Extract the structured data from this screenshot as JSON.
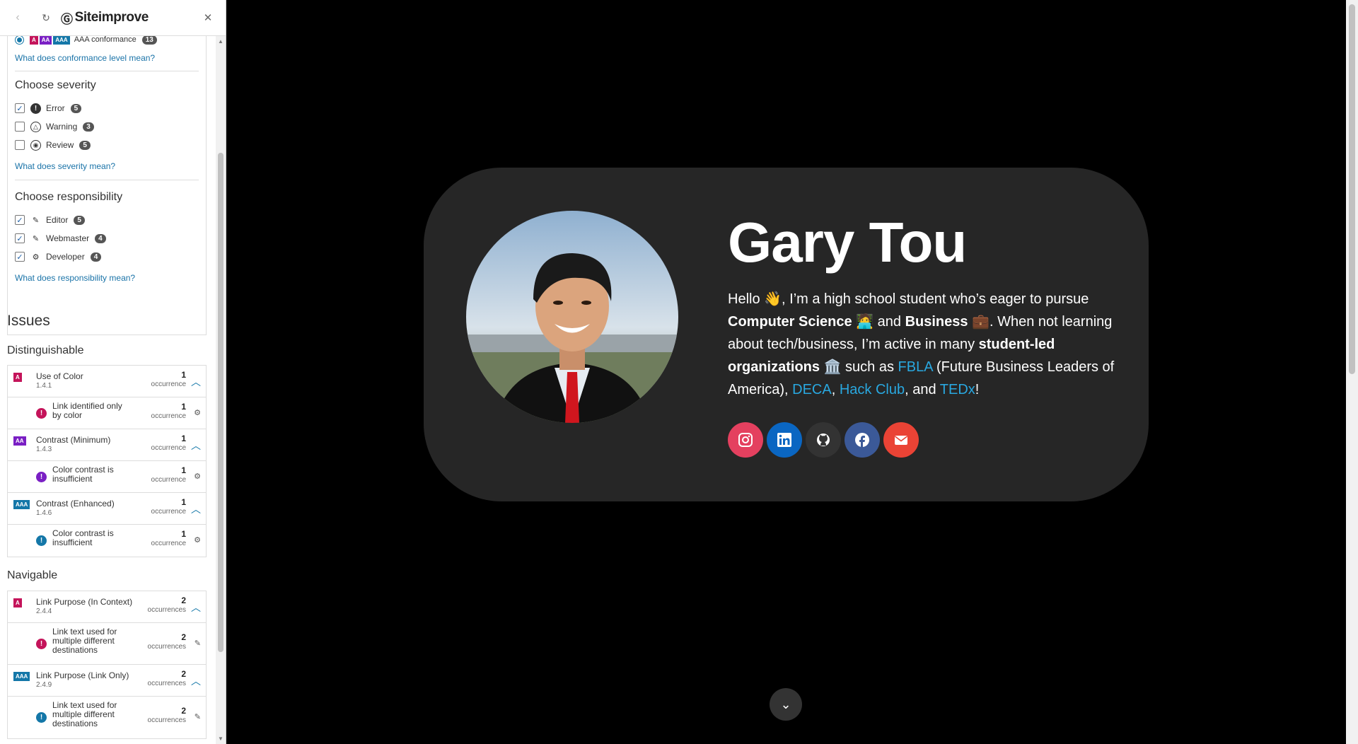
{
  "panel": {
    "brand": "Siteimprove",
    "filters": {
      "conformance_selected_label": "AAA conformance",
      "conformance_selected_count": "13",
      "conformance_link": "What does conformance level mean?",
      "severity_title": "Choose severity",
      "severity": [
        {
          "label": "Error",
          "count": "5",
          "checked": true
        },
        {
          "label": "Warning",
          "count": "3",
          "checked": false
        },
        {
          "label": "Review",
          "count": "5",
          "checked": false
        }
      ],
      "severity_link": "What does severity mean?",
      "responsibility_title": "Choose responsibility",
      "responsibility": [
        {
          "label": "Editor",
          "count": "5",
          "checked": true
        },
        {
          "label": "Webmaster",
          "count": "4",
          "checked": true
        },
        {
          "label": "Developer",
          "count": "4",
          "checked": true
        }
      ],
      "responsibility_link": "What does responsibility mean?"
    },
    "issues_title": "Issues",
    "categories": [
      {
        "name": "Distinguishable",
        "criteria": [
          {
            "level": "A",
            "name": "Use of Color",
            "number": "1.4.1",
            "count": "1",
            "unit": "occurrence",
            "issue": {
              "severity": "error",
              "name": "Link identified only by color",
              "count": "1",
              "unit": "occurrence"
            }
          },
          {
            "level": "AA",
            "name": "Contrast (Minimum)",
            "number": "1.4.3",
            "count": "1",
            "unit": "occurrence",
            "issue": {
              "severity": "error",
              "name": "Color contrast is insufficient",
              "count": "1",
              "unit": "occurrence"
            }
          },
          {
            "level": "AAA",
            "name": "Contrast (Enhanced)",
            "number": "1.4.6",
            "count": "1",
            "unit": "occurrence",
            "issue": {
              "severity": "error",
              "name": "Color contrast is insufficient",
              "count": "1",
              "unit": "occurrence"
            }
          }
        ]
      },
      {
        "name": "Navigable",
        "criteria": [
          {
            "level": "A",
            "name": "Link Purpose (In Context)",
            "number": "2.4.4",
            "count": "2",
            "unit": "occurrences",
            "issue": {
              "severity": "error",
              "name": "Link text used for multiple different destinations",
              "count": "2",
              "unit": "occurrences"
            }
          },
          {
            "level": "AAA",
            "name": "Link Purpose (Link Only)",
            "number": "2.4.9",
            "count": "2",
            "unit": "occurrences",
            "issue": {
              "severity": "error",
              "name": "Link text used for multiple different destinations",
              "count": "2",
              "unit": "occurrences"
            }
          }
        ]
      }
    ]
  },
  "site": {
    "name": "Gary Tou",
    "bio": {
      "p1": "Hello 👋, I’m a high school student who’s eager to pursue ",
      "b1": "Computer Science",
      "p2": " 🧑‍💻 and ",
      "b2": "Business",
      "p3": " 💼. When not learning about tech/business, I’m active in many ",
      "b3": "student-led organizations",
      "p4": " 🏛️ such as ",
      "l1": "FBLA",
      "p5": " (Future Business Leaders of America), ",
      "l2": "DECA",
      "p6": ", ",
      "l3": "Hack Club",
      "p7": ", and ",
      "l4": "TEDx",
      "p8": "!"
    },
    "socials": [
      {
        "icon": "instagram-icon",
        "color": "#e4405f"
      },
      {
        "icon": "linkedin-icon",
        "color": "#0a66c2"
      },
      {
        "icon": "github-icon",
        "color": "#333333"
      },
      {
        "icon": "facebook-icon",
        "color": "#3b5998"
      },
      {
        "icon": "email-icon",
        "color": "#ea4335"
      }
    ]
  },
  "colors": {
    "level_A": "#c4145a",
    "level_AA": "#7a1fc4",
    "level_AAA": "#1477a8",
    "error": "#c4145a",
    "link": "#29a8e0"
  }
}
